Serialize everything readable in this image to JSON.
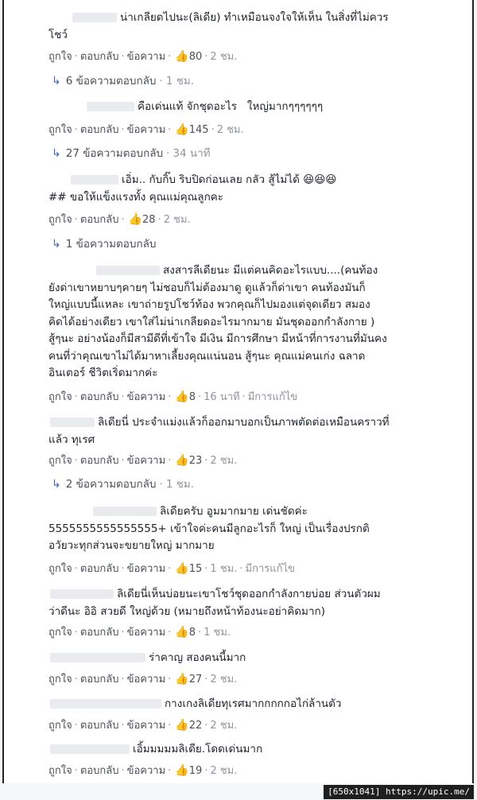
{
  "labels": {
    "like": "ถูกใจ",
    "reply": "ตอบกลับ",
    "message": "ข้อความ",
    "edited": "มีการแก้ไข",
    "dot": "·"
  },
  "comments": [
    {
      "lines": [
        "น่าเกลียดไปนะ(ลิเดีย) ทำเหมือนจงใจให้เห็น ในสิ่งที่ไม่ควร",
        "โชว์"
      ],
      "likes": "80",
      "time": "2 ชม.",
      "replies": "6 ข้อความตอบกลับ",
      "reply_time": "1 ชม."
    },
    {
      "lines": [
        "คือเด่นแท้ จักชุดอะไร   ใหญ่มากๆๆๆๆๆๆ"
      ],
      "likes": "145",
      "time": "2 ชม.",
      "replies": "27 ข้อความตอบกลับ",
      "reply_time": "34 นาที"
    },
    {
      "lines": [
        "เอิ่ม.. กับกิ๊บ ริบปิดก่อนเลย กลัว สู้ไม่ได้ 😆😆😆",
        "## ขอให้แข็งแรงทั้ง คุณแม่คุณลูกคะ"
      ],
      "likes": "28",
      "time": "2 ชม.",
      "replies": "1 ข้อความตอบกลับ",
      "reply_time": ""
    },
    {
      "lines": [
        "สงสารลีเดียนะ มีแต่คนคิดอะไรแบบ....(คนท้อง",
        "ยังด่าเขาหยาบๆคายๆ ไม่ชอบก็ไม่ต้องมาดู ดูแล้วก็ด่าเขา คนท้องมันก็",
        "ใหญ่แบบนี้แหละ เขาถ่ายรูปโชว์ท้อง พวกคุณก็ไปมองแต่จุดเดียว สมอง",
        "คิดได้อย่างเดียว เขาใส่ไม่น่าเกลียดอะไรมากมาย มันชุดออกกำลังกาย )",
        "สู้ๆนะ อย่างน้องก็มีสามีดีที่เข้าใจ มีเงิน มีการศึกษา มีหน้าที่การงานที่มันคง",
        "คนที่ว่าคุณเขาไม่ได้มาหาเลี้ยงคุณแน่นอน สู้ๆนะ คุณแม่คนเก่ง ฉลาด",
        "อินเตอร์ ชีวิตเริ่ดมากค่ะ"
      ],
      "likes": "8",
      "time": "16 นาที",
      "edited": true
    },
    {
      "lines": [
        "ลิเดียนี่ ประจำแม่งแล้วก็ออกมาบอกเป็นภาพตัดต่อเหมือนคราวที่",
        "แล้ว ทุเรศ"
      ],
      "likes": "23",
      "time": "2 ชม.",
      "replies": "2 ข้อความตอบกลับ",
      "reply_time": "1 ชม."
    },
    {
      "lines": [
        "ลิเดียครับ อูมมากมาย เด่นชัดค่ะ",
        "5555555555555555+ เข้าใจค่ะคนมีลูกอะไรก็ ใหญ่ เป็นเรื่องปรกติ",
        "อวัยวะทุกส่วนจะขยายใหญ่ มากมาย"
      ],
      "likes": "15",
      "time": "1 ชม.",
      "edited": true
    },
    {
      "lines": [
        "ลิเดียนี่เห็นบ่อยนะเขาโชว์ชุดออกกำลังกายบ่อย ส่วนตัวผม",
        "ว่าดีนะ อิอิ สวยดี ใหญ่ด้วย (หมายถึงหน้าท้องนะอย่าคิดมาก)"
      ],
      "likes": "8",
      "time": "1 ชม."
    },
    {
      "lines": [
        "ร่าคาญ สองคนนี้มาก"
      ],
      "likes": "27",
      "time": "2 ชม."
    },
    {
      "lines": [
        "กางเกงลิเดียทุเรศมากกกกกอไก่ล้านตัว"
      ],
      "likes": "22",
      "time": "2 ชม."
    },
    {
      "lines": [
        "เอิ้มมมมมลิเดีย.โดดเด่นมาก"
      ],
      "likes": "19",
      "time": "2 ชม."
    }
  ],
  "watermark": "[650x1041] https://upic.me/",
  "colors": {
    "link": "#4267b2",
    "meta": "#90949c",
    "text": "#1d2129"
  }
}
